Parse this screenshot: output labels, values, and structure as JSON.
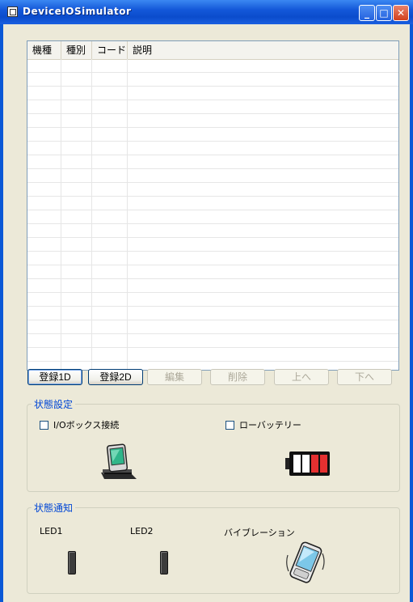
{
  "window": {
    "title": "DeviceIOSimulator",
    "minimize_glyph": "_",
    "maximize_glyph": "□",
    "close_glyph": "✕"
  },
  "list": {
    "columns": [
      "機種",
      "種別",
      "コード",
      "説明"
    ],
    "rows": []
  },
  "buttons": {
    "register1d": "登録1D",
    "register2d": "登録2D",
    "edit": "編集",
    "delete": "削除",
    "up": "上へ",
    "down": "下へ"
  },
  "state_settings": {
    "title": "状態設定",
    "io_box_label": "I/Oボックス接続",
    "io_box_checked": false,
    "low_battery_label": "ローバッテリー",
    "low_battery_checked": false,
    "icons": [
      "cradle-device-icon",
      "battery-low-icon"
    ]
  },
  "state_notify": {
    "title": "状態通知",
    "led1_label": "LED1",
    "led2_label": "LED2",
    "vibration_label": "バイブレーション",
    "icons": [
      "led1-indicator",
      "led2-indicator",
      "vibration-device-icon"
    ]
  }
}
